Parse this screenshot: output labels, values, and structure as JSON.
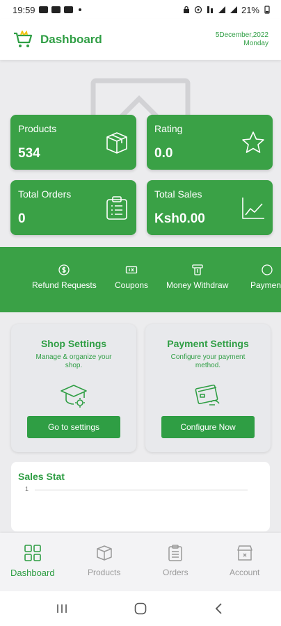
{
  "status_bar": {
    "time": "19:59",
    "battery": "21%"
  },
  "header": {
    "logo_icon": "cart-logo-icon",
    "title": "Dashboard",
    "date_line1": "5December,2022",
    "date_line2": "Monday"
  },
  "stats": [
    {
      "label": "Products",
      "value": "534",
      "icon": "box-icon"
    },
    {
      "label": "Rating",
      "value": "0.0",
      "icon": "star-icon"
    },
    {
      "label": "Total Orders",
      "value": "0",
      "icon": "clipboard-icon"
    },
    {
      "label": "Total Sales",
      "value": "Ksh0.00",
      "icon": "line-chart-icon"
    }
  ],
  "quick_actions": [
    {
      "label": "Refund Requests",
      "icon": "refund-icon"
    },
    {
      "label": "Coupons",
      "icon": "coupon-icon"
    },
    {
      "label": "Money Withdraw",
      "icon": "withdraw-icon"
    },
    {
      "label": "Payment",
      "icon": "payment-icon"
    }
  ],
  "shop_settings": {
    "title": "Shop Settings",
    "description": "Manage & organize your shop.",
    "button": "Go to settings",
    "icon": "graduation-cap-settings-icon"
  },
  "payment_settings": {
    "title": "Payment Settings",
    "description": "Configure your payment method.",
    "button": "Configure Now",
    "icon": "credit-card-icon"
  },
  "sales_stat": {
    "title": "Sales Stat",
    "tick": "1"
  },
  "bottom_nav": [
    {
      "label": "Dashboard",
      "icon": "dashboard-grid-icon",
      "active": true
    },
    {
      "label": "Products",
      "icon": "box-icon",
      "active": false
    },
    {
      "label": "Orders",
      "icon": "clipboard-icon",
      "active": false
    },
    {
      "label": "Account",
      "icon": "store-icon",
      "active": false
    }
  ],
  "colors": {
    "brand_green": "#3aa146",
    "text_green": "#2f9e44",
    "inactive_grey": "#9a9a9a"
  }
}
